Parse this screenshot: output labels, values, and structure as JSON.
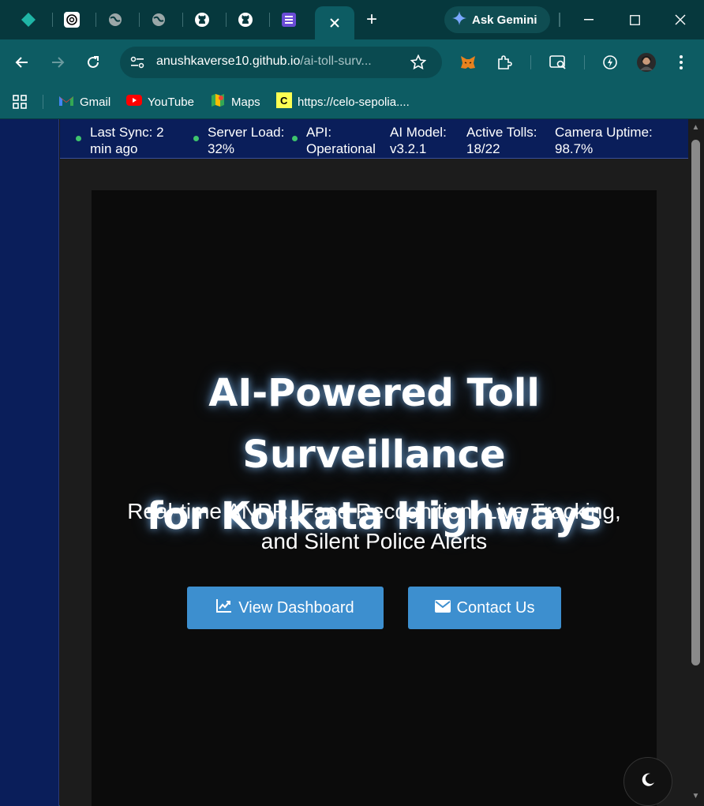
{
  "browser": {
    "tabs": [
      {
        "icon": "diamond-icon"
      },
      {
        "icon": "chatgpt-icon"
      },
      {
        "icon": "globe-icon"
      },
      {
        "icon": "globe-icon"
      },
      {
        "icon": "github-icon"
      },
      {
        "icon": "github-icon"
      },
      {
        "icon": "list-icon"
      },
      {
        "icon": "close-icon",
        "active": true
      }
    ],
    "new_tab": "+",
    "gemini_label": "Ask Gemini",
    "url_main": "anushkaverse10.github.io",
    "url_path": "/ai-toll-surv...",
    "bookmarks": [
      {
        "label": "Gmail",
        "icon": "gmail-icon"
      },
      {
        "label": "YouTube",
        "icon": "youtube-icon"
      },
      {
        "label": "Maps",
        "icon": "maps-icon"
      },
      {
        "label": "https://celo-sepolia....",
        "icon": "celo-icon"
      }
    ]
  },
  "status": {
    "last_sync": "Last Sync: 2 min ago",
    "server_load": "Server Load: 32%",
    "api": "API: Operational",
    "ai_model": "AI Model: v3.2.1",
    "active_tolls": "Active Tolls: 18/22",
    "camera_uptime": "Camera Uptime: 98.7%"
  },
  "hero": {
    "title_line1": "AI-Powered Toll Surveillance",
    "title_line2": "for Kolkata Highways",
    "subtitle": "Real-time ANPR, Face Recognition, Live Tracking, and Silent Police Alerts",
    "dashboard_label": "View Dashboard",
    "contact_label": "Contact Us"
  },
  "colors": {
    "accent": "#3d8fcf",
    "status_bar": "#0a1e5a",
    "browser_chrome": "#0d5c63",
    "status_dot": "#3ec46d"
  }
}
